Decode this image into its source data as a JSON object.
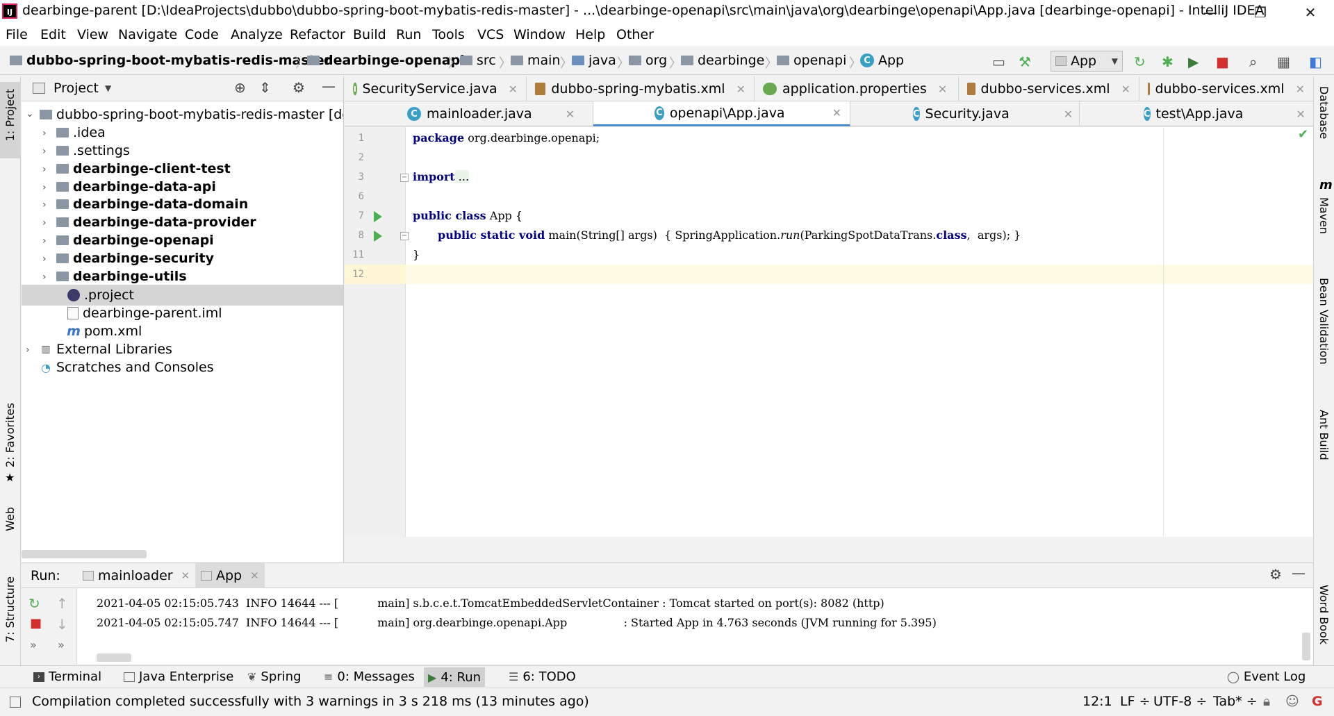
{
  "window": {
    "title": "dearbinge-parent [D:\\IdeaProjects\\dubbo\\dubbo-spring-boot-mybatis-redis-master] - ...\\dearbinge-openapi\\src\\main\\java\\org\\dearbinge\\openapi\\App.java [dearbinge-openapi] - IntelliJ IDEA",
    "logo_text": "IJ",
    "minimize": "—",
    "restore": "❐",
    "close": "✕"
  },
  "menu": [
    "File",
    "Edit",
    "View",
    "Navigate",
    "Code",
    "Analyze",
    "Refactor",
    "Build",
    "Run",
    "Tools",
    "VCS",
    "Window",
    "Help",
    "Other"
  ],
  "breadcrumbs": [
    "dubbo-spring-boot-mybatis-redis-master",
    "dearbinge-openapi",
    "src",
    "main",
    "java",
    "org",
    "dearbinge",
    "openapi",
    "App"
  ],
  "run_config": "App",
  "left_strip": {
    "project": "1: Project",
    "favorites": "2: Favorites",
    "web": "Web",
    "structure": "7: Structure"
  },
  "right_strip": {
    "database": "Database",
    "maven": "Maven",
    "bean_validation": "Bean Validation",
    "ant_build": "Ant Build",
    "word_book": "Word Book"
  },
  "project_panel": {
    "title": "Project",
    "root": "dubbo-spring-boot-mybatis-redis-master [dea",
    "items": [
      ".idea",
      ".settings",
      "dearbinge-client-test",
      "dearbinge-data-api",
      "dearbinge-data-domain",
      "dearbinge-data-provider",
      "dearbinge-openapi",
      "dearbinge-security",
      "dearbinge-utils",
      ".project",
      "dearbinge-parent.iml",
      "pom.xml"
    ],
    "external": "External Libraries",
    "scratches": "Scratches and Consoles"
  },
  "tabs_row1": [
    "SecurityService.java",
    "dubbo-spring-mybatis.xml",
    "application.properties",
    "dubbo-services.xml",
    "dubbo-services.xml"
  ],
  "tabs_row2": [
    "mainloader.java",
    "openapi\\App.java",
    "Security.java",
    "test\\App.java"
  ],
  "editor": {
    "line_numbers": [
      "1",
      "2",
      "3",
      "6",
      "7",
      "8",
      "11",
      "12"
    ],
    "l1_kw": "package",
    "l1_rest": " org.dearbinge.openapi;",
    "l3_kw": "import",
    "l3_rest": " ...",
    "l7_kw": "public class",
    "l7_rest": " App {",
    "l8_kw": "public static void",
    "l8_rest1": " main(String[] args)  { SpringApplication.",
    "l8_run": "run",
    "l8_rest2": "(ParkingSpotDataTrans.",
    "l8_class": "class",
    "l8_rest3": ",  args); }",
    "l11": "}"
  },
  "run_panel": {
    "label": "Run:",
    "tabs": [
      "mainloader",
      "App"
    ],
    "log": [
      "2021-04-05 02:15:05.743  INFO 14644 --- [           main] s.b.c.e.t.TomcatEmbeddedServletContainer : Tomcat started on port(s): 8082 (http)",
      "2021-04-05 02:15:05.747  INFO 14644 --- [           main] org.dearbinge.openapi.App                : Started App in 4.763 seconds (JVM running for 5.395)"
    ]
  },
  "bottom_tools": [
    "Terminal",
    "Java Enterprise",
    "Spring",
    "0: Messages",
    "4: Run",
    "6: TODO"
  ],
  "event_log": "Event Log",
  "status": {
    "message": "Compilation completed successfully with 3 warnings in 3 s 218 ms (13 minutes ago)",
    "position": "12:1",
    "line_sep": "LF ÷",
    "encoding": "UTF-8 ÷",
    "indent": "Tab* ÷"
  }
}
